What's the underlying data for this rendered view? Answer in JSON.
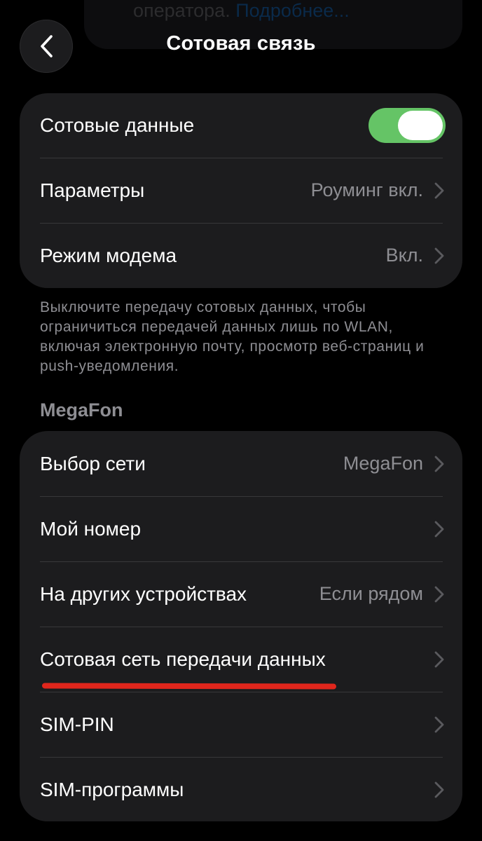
{
  "background_hint": {
    "text": "оператора.",
    "link": "Подробнее..."
  },
  "header": {
    "title": "Сотовая связь",
    "back_icon": "chevron-left-icon"
  },
  "group_main": {
    "rows": [
      {
        "label": "Сотовые данные",
        "toggle_on": true
      },
      {
        "label": "Параметры",
        "value": "Роуминг вкл."
      },
      {
        "label": "Режим модема",
        "value": "Вкл."
      }
    ]
  },
  "footnote": "Выключите передачу сотовых данных, чтобы ограничиться передачей данных лишь по WLAN, включая электронную почту, просмотр веб-страниц и push-уведомления.",
  "carrier_section": {
    "title": "MegaFon",
    "rows": [
      {
        "label": "Выбор сети",
        "value": "MegaFon"
      },
      {
        "label": "Мой номер",
        "value": ""
      },
      {
        "label": "На других устройствах",
        "value": "Если рядом"
      },
      {
        "label": "Сотовая сеть передачи данных",
        "value": ""
      },
      {
        "label": "SIM-PIN",
        "value": ""
      },
      {
        "label": "SIM-программы",
        "value": ""
      }
    ]
  },
  "colors": {
    "accent_toggle": "#65c466",
    "annotation": "#e0261c",
    "cell_background": "#1c1c1e",
    "secondary_text": "#8e8e93"
  }
}
